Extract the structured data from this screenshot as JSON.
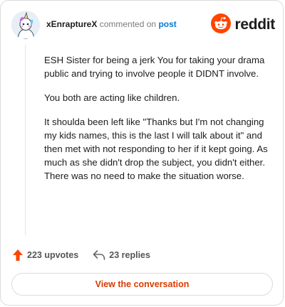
{
  "comment": {
    "username": "xEnraptureX",
    "action_text": "commented on",
    "post_link": "post",
    "paragraphs": [
      "ESH Sister for being a jerk You for taking your drama public and trying to involve people it DIDNT involve.",
      "You both are acting like children.",
      "It shoulda been left like \"Thanks but I'm not changing my kids names, this is the last I will talk about it\" and then met with not responding to her if it kept going. As much as she didn't drop the subject, you didn't either. There was no need to make the situation worse."
    ]
  },
  "brand": {
    "name": "reddit",
    "icon": "reddit-snoo-icon",
    "color": "#ff4500"
  },
  "actions": {
    "upvotes": "223 upvotes",
    "replies": "23 replies",
    "upvote_icon": "upvote-arrow-icon",
    "reply_icon": "reply-arrow-icon",
    "upvote_color": "#ff4500"
  },
  "cta": {
    "label": "View the conversation",
    "color": "#d93a00"
  },
  "avatar": {
    "icon": "user-avatar-unicorn-icon"
  }
}
